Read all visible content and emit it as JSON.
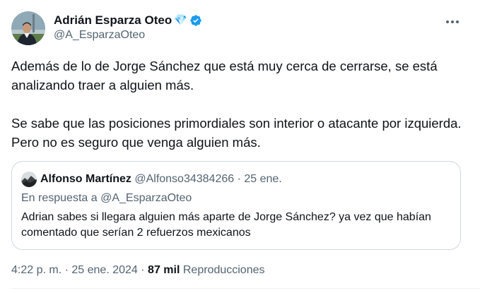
{
  "author": {
    "display_name": "Adrián Esparza Oteo",
    "handle": "@A_EsparzaOteo",
    "badge_emoji": "💎",
    "verified_color": "#1d9bf0"
  },
  "tweet": {
    "text": "Además de lo de Jorge Sánchez que está muy cerca de cerrarse, se está analizando traer a alguien más.\n\nSe sabe que las posiciones primordiales son interior o atacante por izquierda. Pero no es seguro que venga alguien más."
  },
  "quoted": {
    "display_name": "Alfonso Martínez",
    "handle": "@Alfonso34384266",
    "separator": "·",
    "date": "25 ene.",
    "reply_prefix": "En respuesta a",
    "reply_to": "@A_EsparzaOteo",
    "text": "Adrian sabes si llegara alguien más aparte de Jorge Sánchez? ya vez que habían comentado que serían 2 refuerzos mexicanos"
  },
  "meta": {
    "time": "4:22 p. m.",
    "separator": "·",
    "date": "25 ene. 2024",
    "views_count": "87 mil",
    "views_label": "Reproducciones"
  },
  "icons": {
    "more": "more-horizontal-icon",
    "verified": "verified-badge-icon"
  }
}
